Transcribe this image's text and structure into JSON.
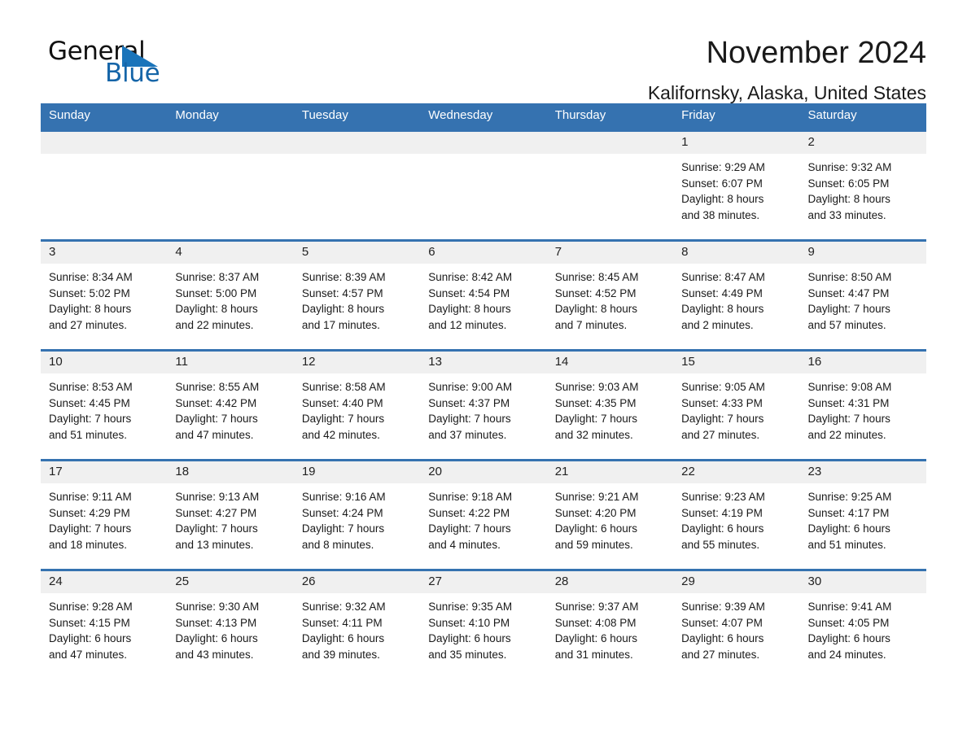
{
  "brand": {
    "name_part1": "General",
    "name_part2": "Blue",
    "triangle_color": "#1a74ba",
    "blue_text_color": "#1565a8"
  },
  "header": {
    "title": "November 2024",
    "location": "Kalifornsky, Alaska, United States"
  },
  "colors": {
    "header_blue": "#3572b0",
    "day_band_gray": "#f0f0f0",
    "text": "#1a1a1a"
  },
  "weekday_headers": [
    "Sunday",
    "Monday",
    "Tuesday",
    "Wednesday",
    "Thursday",
    "Friday",
    "Saturday"
  ],
  "weeks": [
    [
      {
        "day": "",
        "sunrise": "",
        "sunset": "",
        "daylight_line1": "",
        "daylight_line2": ""
      },
      {
        "day": "",
        "sunrise": "",
        "sunset": "",
        "daylight_line1": "",
        "daylight_line2": ""
      },
      {
        "day": "",
        "sunrise": "",
        "sunset": "",
        "daylight_line1": "",
        "daylight_line2": ""
      },
      {
        "day": "",
        "sunrise": "",
        "sunset": "",
        "daylight_line1": "",
        "daylight_line2": ""
      },
      {
        "day": "",
        "sunrise": "",
        "sunset": "",
        "daylight_line1": "",
        "daylight_line2": ""
      },
      {
        "day": "1",
        "sunrise": "Sunrise: 9:29 AM",
        "sunset": "Sunset: 6:07 PM",
        "daylight_line1": "Daylight: 8 hours",
        "daylight_line2": "and 38 minutes."
      },
      {
        "day": "2",
        "sunrise": "Sunrise: 9:32 AM",
        "sunset": "Sunset: 6:05 PM",
        "daylight_line1": "Daylight: 8 hours",
        "daylight_line2": "and 33 minutes."
      }
    ],
    [
      {
        "day": "3",
        "sunrise": "Sunrise: 8:34 AM",
        "sunset": "Sunset: 5:02 PM",
        "daylight_line1": "Daylight: 8 hours",
        "daylight_line2": "and 27 minutes."
      },
      {
        "day": "4",
        "sunrise": "Sunrise: 8:37 AM",
        "sunset": "Sunset: 5:00 PM",
        "daylight_line1": "Daylight: 8 hours",
        "daylight_line2": "and 22 minutes."
      },
      {
        "day": "5",
        "sunrise": "Sunrise: 8:39 AM",
        "sunset": "Sunset: 4:57 PM",
        "daylight_line1": "Daylight: 8 hours",
        "daylight_line2": "and 17 minutes."
      },
      {
        "day": "6",
        "sunrise": "Sunrise: 8:42 AM",
        "sunset": "Sunset: 4:54 PM",
        "daylight_line1": "Daylight: 8 hours",
        "daylight_line2": "and 12 minutes."
      },
      {
        "day": "7",
        "sunrise": "Sunrise: 8:45 AM",
        "sunset": "Sunset: 4:52 PM",
        "daylight_line1": "Daylight: 8 hours",
        "daylight_line2": "and 7 minutes."
      },
      {
        "day": "8",
        "sunrise": "Sunrise: 8:47 AM",
        "sunset": "Sunset: 4:49 PM",
        "daylight_line1": "Daylight: 8 hours",
        "daylight_line2": "and 2 minutes."
      },
      {
        "day": "9",
        "sunrise": "Sunrise: 8:50 AM",
        "sunset": "Sunset: 4:47 PM",
        "daylight_line1": "Daylight: 7 hours",
        "daylight_line2": "and 57 minutes."
      }
    ],
    [
      {
        "day": "10",
        "sunrise": "Sunrise: 8:53 AM",
        "sunset": "Sunset: 4:45 PM",
        "daylight_line1": "Daylight: 7 hours",
        "daylight_line2": "and 51 minutes."
      },
      {
        "day": "11",
        "sunrise": "Sunrise: 8:55 AM",
        "sunset": "Sunset: 4:42 PM",
        "daylight_line1": "Daylight: 7 hours",
        "daylight_line2": "and 47 minutes."
      },
      {
        "day": "12",
        "sunrise": "Sunrise: 8:58 AM",
        "sunset": "Sunset: 4:40 PM",
        "daylight_line1": "Daylight: 7 hours",
        "daylight_line2": "and 42 minutes."
      },
      {
        "day": "13",
        "sunrise": "Sunrise: 9:00 AM",
        "sunset": "Sunset: 4:37 PM",
        "daylight_line1": "Daylight: 7 hours",
        "daylight_line2": "and 37 minutes."
      },
      {
        "day": "14",
        "sunrise": "Sunrise: 9:03 AM",
        "sunset": "Sunset: 4:35 PM",
        "daylight_line1": "Daylight: 7 hours",
        "daylight_line2": "and 32 minutes."
      },
      {
        "day": "15",
        "sunrise": "Sunrise: 9:05 AM",
        "sunset": "Sunset: 4:33 PM",
        "daylight_line1": "Daylight: 7 hours",
        "daylight_line2": "and 27 minutes."
      },
      {
        "day": "16",
        "sunrise": "Sunrise: 9:08 AM",
        "sunset": "Sunset: 4:31 PM",
        "daylight_line1": "Daylight: 7 hours",
        "daylight_line2": "and 22 minutes."
      }
    ],
    [
      {
        "day": "17",
        "sunrise": "Sunrise: 9:11 AM",
        "sunset": "Sunset: 4:29 PM",
        "daylight_line1": "Daylight: 7 hours",
        "daylight_line2": "and 18 minutes."
      },
      {
        "day": "18",
        "sunrise": "Sunrise: 9:13 AM",
        "sunset": "Sunset: 4:27 PM",
        "daylight_line1": "Daylight: 7 hours",
        "daylight_line2": "and 13 minutes."
      },
      {
        "day": "19",
        "sunrise": "Sunrise: 9:16 AM",
        "sunset": "Sunset: 4:24 PM",
        "daylight_line1": "Daylight: 7 hours",
        "daylight_line2": "and 8 minutes."
      },
      {
        "day": "20",
        "sunrise": "Sunrise: 9:18 AM",
        "sunset": "Sunset: 4:22 PM",
        "daylight_line1": "Daylight: 7 hours",
        "daylight_line2": "and 4 minutes."
      },
      {
        "day": "21",
        "sunrise": "Sunrise: 9:21 AM",
        "sunset": "Sunset: 4:20 PM",
        "daylight_line1": "Daylight: 6 hours",
        "daylight_line2": "and 59 minutes."
      },
      {
        "day": "22",
        "sunrise": "Sunrise: 9:23 AM",
        "sunset": "Sunset: 4:19 PM",
        "daylight_line1": "Daylight: 6 hours",
        "daylight_line2": "and 55 minutes."
      },
      {
        "day": "23",
        "sunrise": "Sunrise: 9:25 AM",
        "sunset": "Sunset: 4:17 PM",
        "daylight_line1": "Daylight: 6 hours",
        "daylight_line2": "and 51 minutes."
      }
    ],
    [
      {
        "day": "24",
        "sunrise": "Sunrise: 9:28 AM",
        "sunset": "Sunset: 4:15 PM",
        "daylight_line1": "Daylight: 6 hours",
        "daylight_line2": "and 47 minutes."
      },
      {
        "day": "25",
        "sunrise": "Sunrise: 9:30 AM",
        "sunset": "Sunset: 4:13 PM",
        "daylight_line1": "Daylight: 6 hours",
        "daylight_line2": "and 43 minutes."
      },
      {
        "day": "26",
        "sunrise": "Sunrise: 9:32 AM",
        "sunset": "Sunset: 4:11 PM",
        "daylight_line1": "Daylight: 6 hours",
        "daylight_line2": "and 39 minutes."
      },
      {
        "day": "27",
        "sunrise": "Sunrise: 9:35 AM",
        "sunset": "Sunset: 4:10 PM",
        "daylight_line1": "Daylight: 6 hours",
        "daylight_line2": "and 35 minutes."
      },
      {
        "day": "28",
        "sunrise": "Sunrise: 9:37 AM",
        "sunset": "Sunset: 4:08 PM",
        "daylight_line1": "Daylight: 6 hours",
        "daylight_line2": "and 31 minutes."
      },
      {
        "day": "29",
        "sunrise": "Sunrise: 9:39 AM",
        "sunset": "Sunset: 4:07 PM",
        "daylight_line1": "Daylight: 6 hours",
        "daylight_line2": "and 27 minutes."
      },
      {
        "day": "30",
        "sunrise": "Sunrise: 9:41 AM",
        "sunset": "Sunset: 4:05 PM",
        "daylight_line1": "Daylight: 6 hours",
        "daylight_line2": "and 24 minutes."
      }
    ]
  ]
}
